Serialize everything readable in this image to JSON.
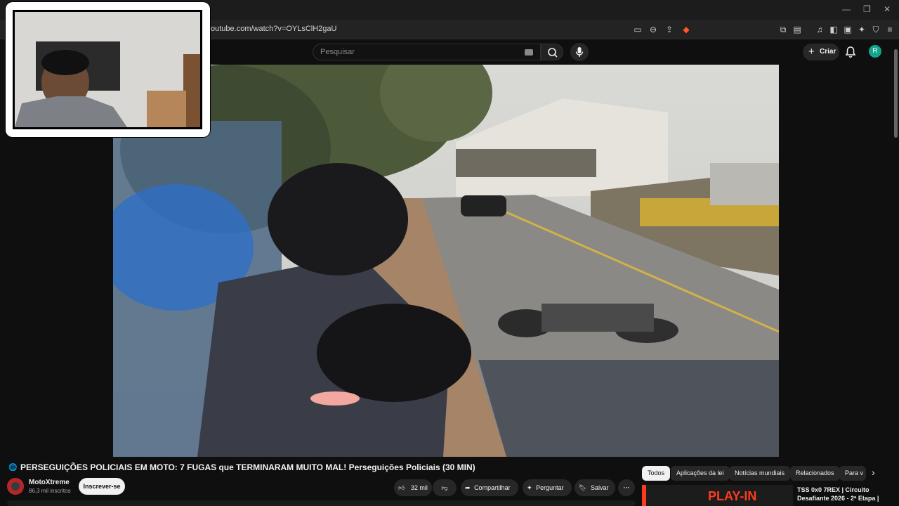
{
  "browser": {
    "url": "outube.com/watch?v=OYLsClH2gaU",
    "minimize_icon": "minimize-icon",
    "maximize_icon": "maximize-icon",
    "close_icon": "close-icon"
  },
  "header": {
    "search_placeholder": "Pesquisar",
    "create_label": "Criar",
    "avatar_letter": "R"
  },
  "video": {
    "title": "PERSEGUIÇÕES POLICIAIS EM MOTO: 7 FUGAS que TERMINARAM MUITO MAL! Perseguições Policiais (30 MIN)"
  },
  "channel": {
    "name": "MotoXtreme",
    "subscribers": "86,3 mil inscritos",
    "subscribe_label": "Inscrever-se"
  },
  "actions": {
    "likes": "32 mil",
    "share_label": "Compartilhar",
    "ask_label": "Perguntar",
    "save_label": "Salvar"
  },
  "chips": [
    "Todos",
    "Aplicações da lei",
    "Notícias mundiais",
    "Relacionados",
    "Para v"
  ],
  "recommendation": {
    "title": "TSS 0x0 7REX |  Circuito Desafiante 2026 - 2ª Etapa |",
    "thumb_text": "PLAY-IN"
  },
  "colors": {
    "background": "#0f0f0f",
    "surface": "#272727",
    "accent_avatar": "#12a48d",
    "channel_avatar": "#b3262a"
  }
}
